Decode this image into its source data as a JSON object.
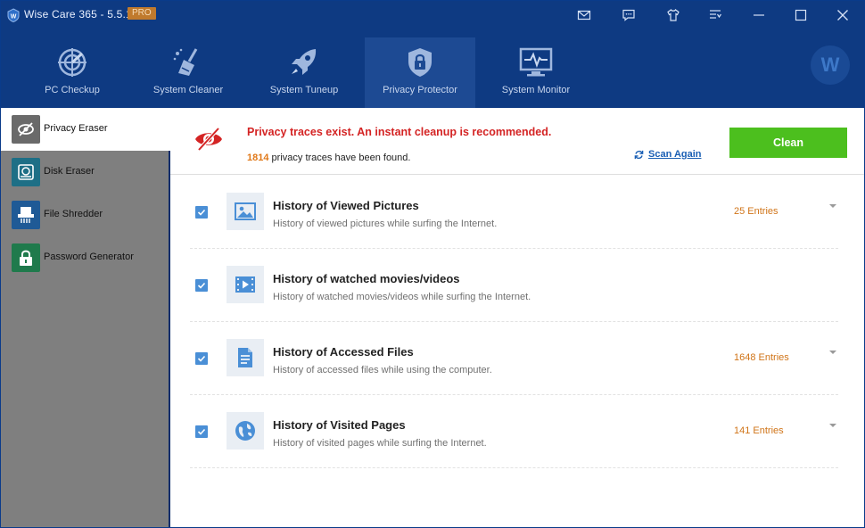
{
  "app": {
    "title": "Wise Care 365 - 5.5.1",
    "badge": "PRO",
    "avatar_letter": "W",
    "brand_color": "#0e3a82",
    "accent_green": "#4cbf1e",
    "alert_red": "#d42424"
  },
  "titlebar": {
    "buttons": [
      "mail-icon",
      "feedback-icon",
      "skin-icon",
      "menu-icon",
      "minimize-icon",
      "maximize-icon",
      "close-icon"
    ]
  },
  "nav": {
    "items": [
      {
        "label": "PC Checkup",
        "icon": "radar-icon"
      },
      {
        "label": "System Cleaner",
        "icon": "broom-icon"
      },
      {
        "label": "System Tuneup",
        "icon": "rocket-icon"
      },
      {
        "label": "Privacy Protector",
        "icon": "lock-shield-icon",
        "active": true
      },
      {
        "label": "System Monitor",
        "icon": "monitor-pulse-icon"
      }
    ]
  },
  "sidebar": {
    "items": [
      {
        "label": "Privacy Eraser",
        "icon": "eye-slash-icon",
        "active": true
      },
      {
        "label": "Disk Eraser",
        "icon": "disk-icon"
      },
      {
        "label": "File Shredder",
        "icon": "shredder-icon"
      },
      {
        "label": "Password Generator",
        "icon": "lock-icon"
      }
    ]
  },
  "alert": {
    "title": "Privacy traces exist. An instant cleanup is recommended.",
    "count": "1814",
    "sub_text": " privacy traces have been found.",
    "scan_again": "Scan Again",
    "clean_button": "Clean"
  },
  "items": [
    {
      "title": "History of Viewed Pictures",
      "desc": "History of viewed pictures while surfing the Internet.",
      "count": "25 Entries",
      "icon": "picture-icon",
      "checked": true
    },
    {
      "title": "History of watched movies/videos",
      "desc": "History of watched movies/videos while surfing the Internet.",
      "count": "",
      "icon": "video-icon",
      "checked": true
    },
    {
      "title": "History of Accessed Files",
      "desc": "History of accessed files while using the computer.",
      "count": "1648 Entries",
      "icon": "document-icon",
      "checked": true
    },
    {
      "title": "History of Visited Pages",
      "desc": "History of visited pages while surfing the Internet.",
      "count": "141 Entries",
      "icon": "globe-icon",
      "checked": true
    }
  ]
}
